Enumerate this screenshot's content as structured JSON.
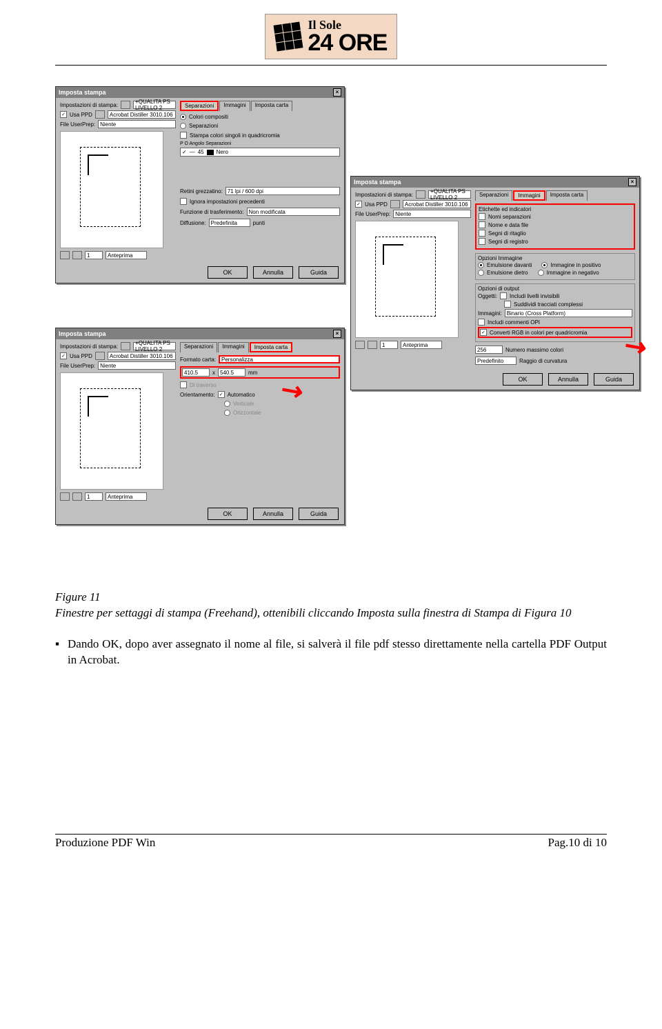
{
  "logo": {
    "top": "Il Sole",
    "main": "24 ORE"
  },
  "dialog_common": {
    "title": "Imposta stampa",
    "settings_label": "Impostazioni di stampa:",
    "settings_value": "+QUALITA PS LIVELLO 2",
    "use_ppd_label": "Usa PPD",
    "ppd_value": "Acrobat Distiller 3010.106",
    "userprep_label": "File UserPrep:",
    "userprep_value": "Niente",
    "status_num": "1",
    "status_text": "Anteprima",
    "tabs": {
      "sep": "Separazioni",
      "img": "Immagini",
      "paper": "Imposta carta"
    },
    "buttons": {
      "ok": "OK",
      "cancel": "Annulla",
      "help": "Guida"
    }
  },
  "dlg_sep": {
    "composite": "Colori compositi",
    "separations": "Separazioni",
    "print_single": "Stampa colori singoli in quadricromia",
    "header": "P  O  Angolo  Separazioni",
    "row_angle": "45",
    "row_name": "Nero",
    "screen_label": "Retini grezzatino:",
    "screen_value": "71 lpi / 600 dpi",
    "ignore": "Ignora impostazioni precedenti",
    "transfer_label": "Funzione di trasferimento:",
    "transfer_value": "Non modificata",
    "diffusion_label": "Diffusione:",
    "diffusion_value": "Predefinita",
    "diffusion_unit": "punti"
  },
  "dlg_paper": {
    "format_label": "Formato carta:",
    "format_value": "Personalizza",
    "w": "410.5",
    "x": "x",
    "h": "540.5",
    "unit": "mm",
    "orient_label": "Orientamento:",
    "auto": "Automatico",
    "vert": "Verticale",
    "horiz": "Orizzontale",
    "trasv": "Di traverso"
  },
  "dlg_img": {
    "labels_group": "Etichette ed indicatori",
    "names_sep": "Nomi separazioni",
    "name_date": "Nome e data file",
    "crop": "Segni di ritaglio",
    "reg": "Segni di registro",
    "img_options": "Opzioni Immagine",
    "emul_front": "Emulsione davanti",
    "emul_back": "Emulsione dietro",
    "img_pos": "Immagine in positivo",
    "img_neg": "Immagine in negativo",
    "output_options": "Opzioni di output",
    "objects": "Oggetti:",
    "incl_invisible": "Includi livelli invisibili",
    "split_complex": "Suddividi tracciati complessi",
    "images_label": "Immagini:",
    "images_value": "Binario (Cross Platform)",
    "incl_opi": "Includi commenti OPI",
    "convert_rgb": "Converti RGB in colori per quadricromia",
    "max_colors_val": "256",
    "max_colors": "Numero massimo colori",
    "curvature_val": "Predefinito",
    "curvature": "Raggio di curvatura"
  },
  "caption": {
    "fig": "Figure 11",
    "text": "Finestre per settaggi di stampa (Freehand), ottenibili cliccando Imposta sulla finestra di Stampa di Figura 10"
  },
  "bullet": "Dando OK, dopo aver assegnato il nome al file, si salverà il file pdf stesso direttamente nella cartella PDF Output in Acrobat.",
  "footer": {
    "left": "Produzione PDF Win",
    "right": "Pag.10 di 10"
  }
}
